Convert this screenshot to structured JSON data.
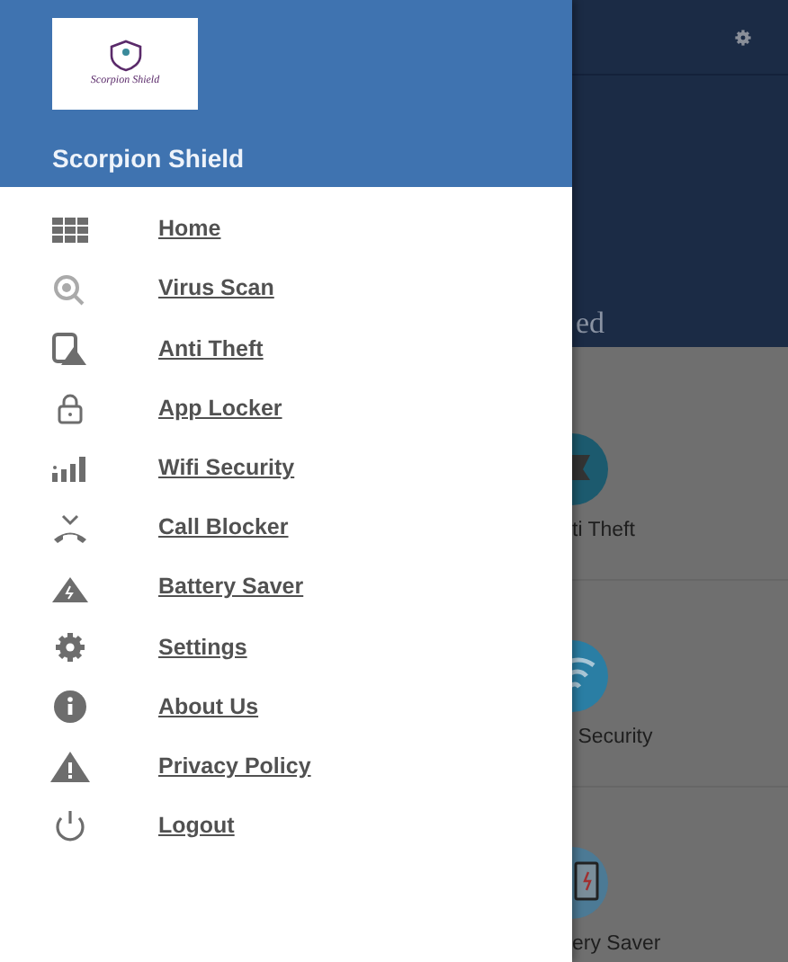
{
  "drawer": {
    "logo_text": "Scorpion Shield",
    "title": "Scorpion Shield",
    "items": [
      {
        "label": "Home"
      },
      {
        "label": "Virus Scan"
      },
      {
        "label": "Anti Theft"
      },
      {
        "label": "App Locker"
      },
      {
        "label": "Wifi Security"
      },
      {
        "label": "Call Blocker"
      },
      {
        "label": "Battery Saver"
      },
      {
        "label": "Settings"
      },
      {
        "label": "About Us"
      },
      {
        "label": "Privacy Policy"
      },
      {
        "label": "Logout"
      }
    ]
  },
  "background": {
    "header_text": "ed",
    "tiles": [
      {
        "label": "ti Theft"
      },
      {
        "label": " Security"
      },
      {
        "label": "ery Saver"
      }
    ]
  }
}
